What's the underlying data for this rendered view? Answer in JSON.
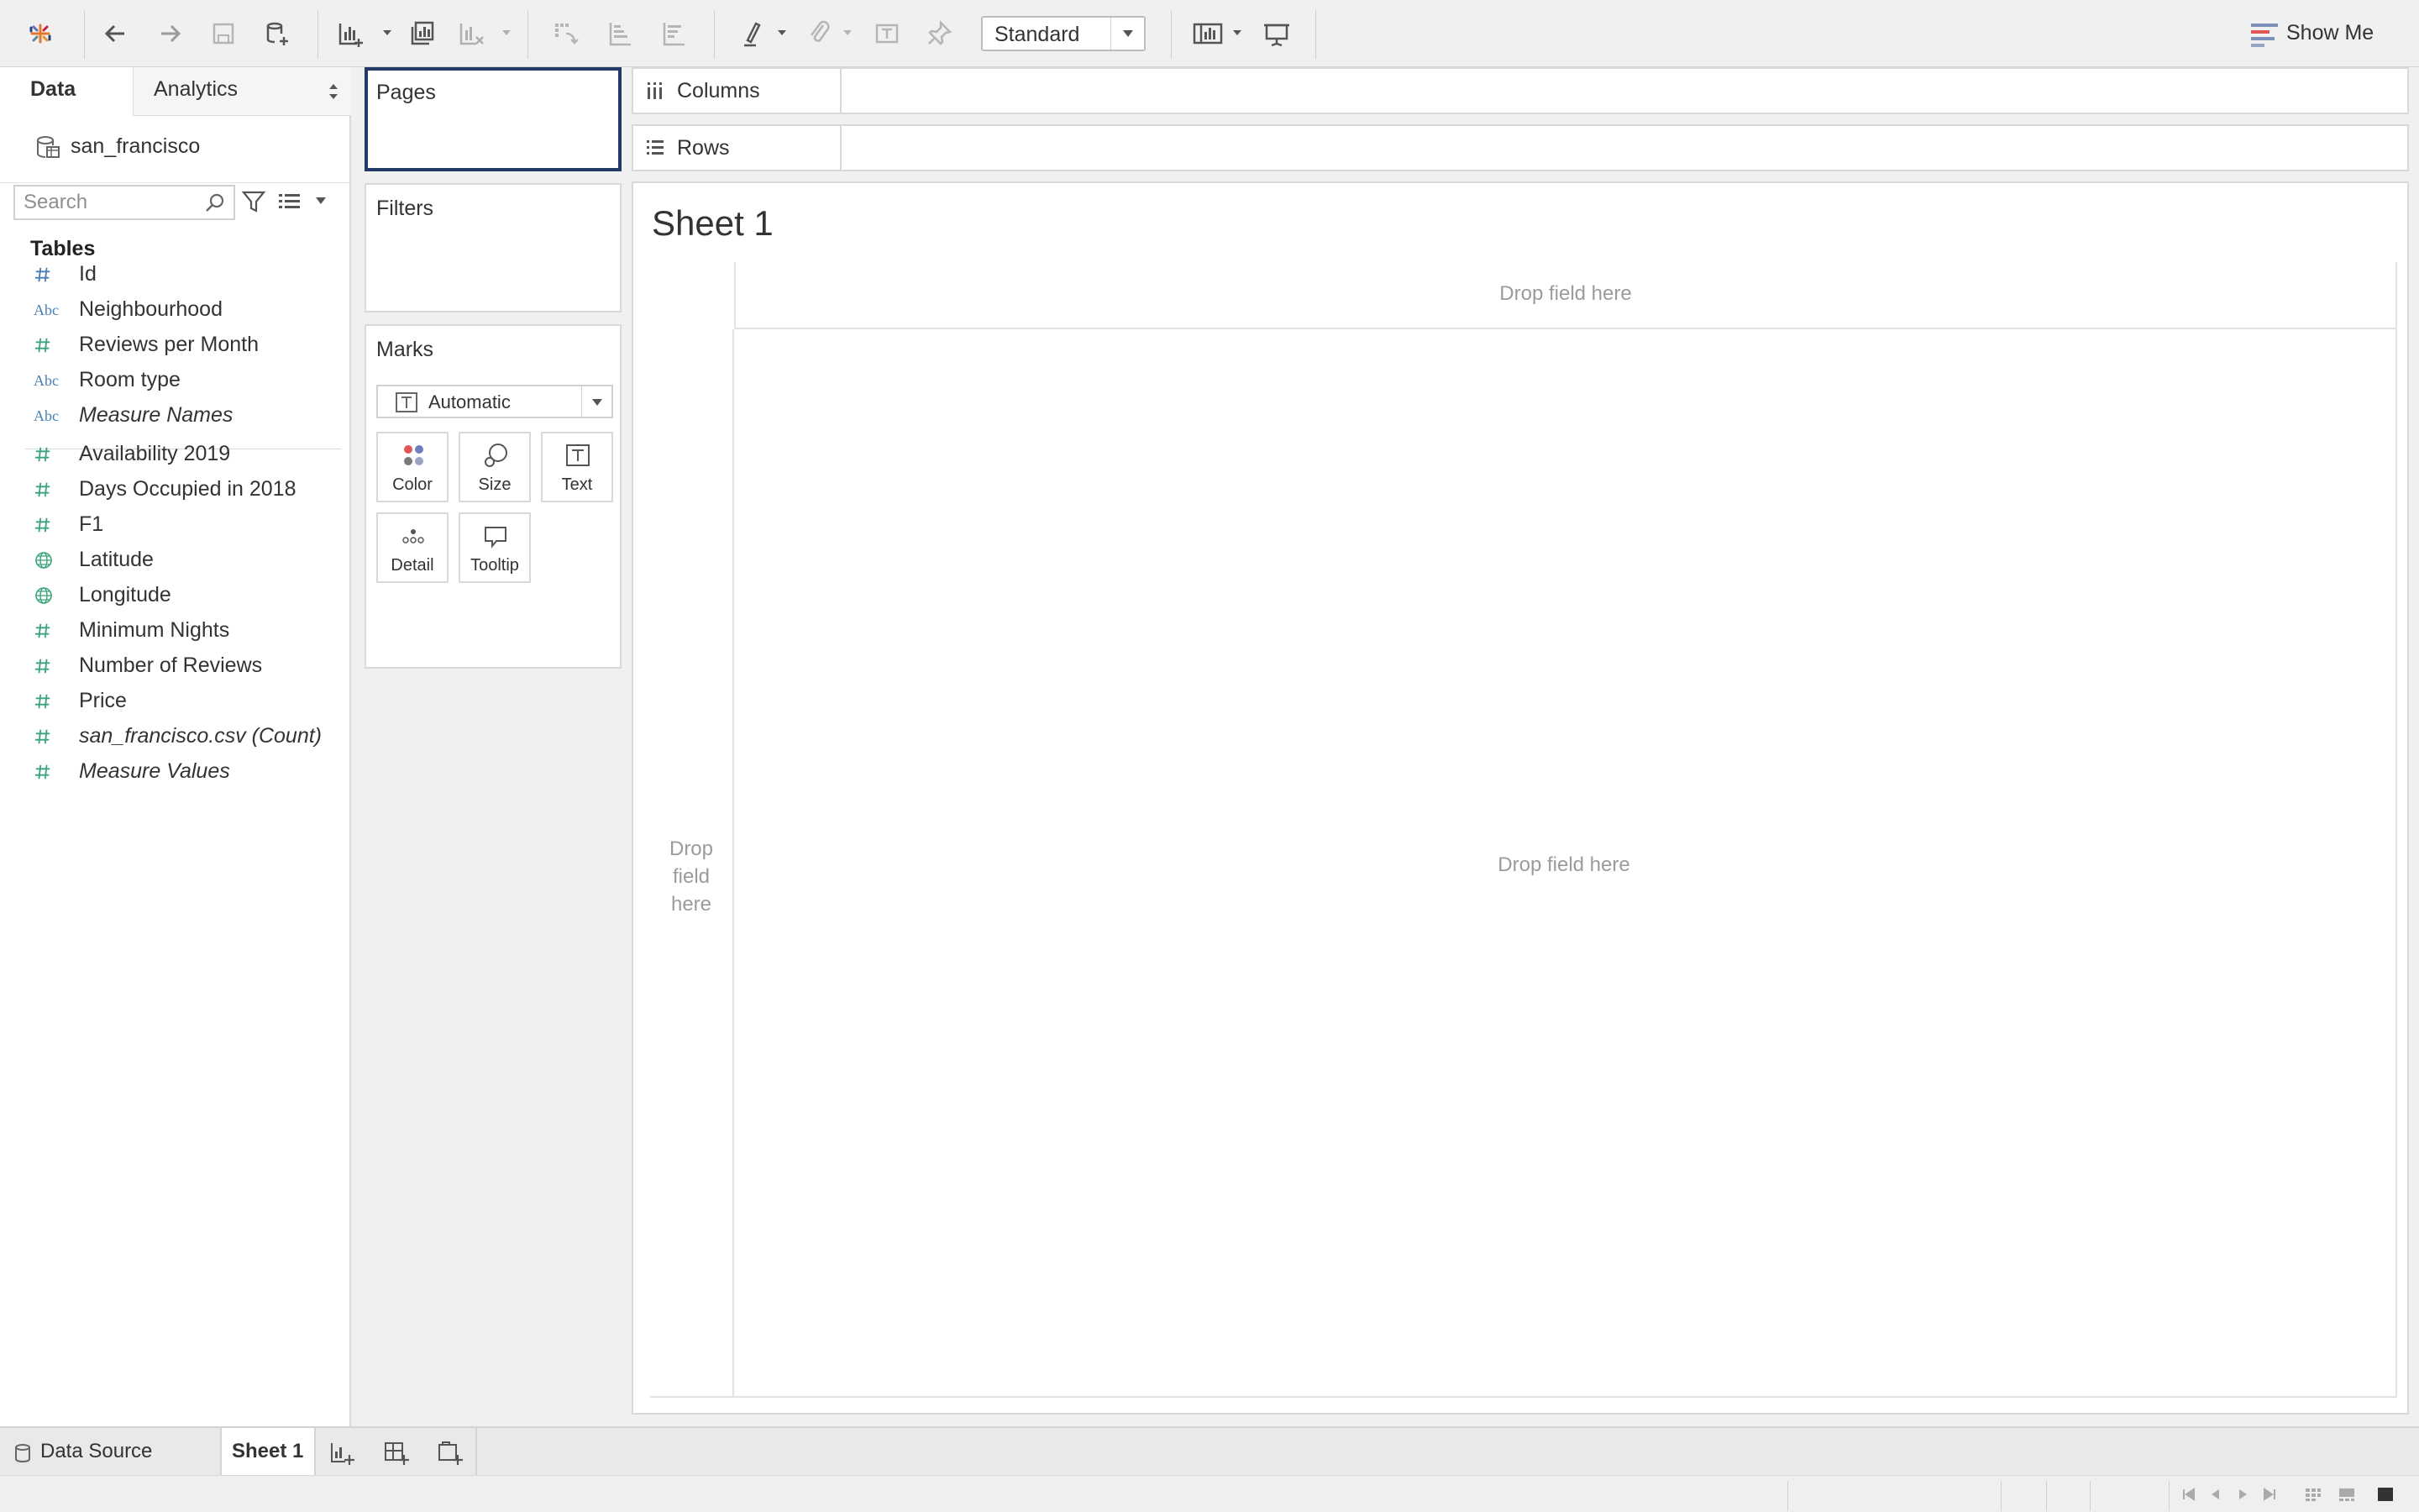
{
  "toolbar": {
    "fit_value": "Standard",
    "show_me_label": "Show Me",
    "icons": [
      "tableau-logo-icon",
      "undo-icon",
      "redo-icon",
      "save-icon",
      "new-datasource-icon",
      "new-worksheet-icon",
      "duplicate-sheet-icon",
      "clear-sheet-icon",
      "swap-icon",
      "sort-ascending-icon",
      "sort-descending-icon",
      "highlight-icon",
      "group-icon",
      "labels-icon",
      "pin-icon",
      "cards-icon",
      "presentation-icon"
    ]
  },
  "data_pane": {
    "tab_data": "Data",
    "tab_analytics": "Analytics",
    "datasource_name": "san_francisco",
    "search_placeholder": "Search",
    "tables_header": "Tables",
    "fields": [
      {
        "name": "Id",
        "type": "number"
      },
      {
        "name": "Neighbourhood",
        "type": "string"
      },
      {
        "name": "Reviews per Month",
        "type": "number"
      },
      {
        "name": "Room type",
        "type": "string"
      },
      {
        "name": "Measure Names",
        "type": "string",
        "italic": true
      },
      {
        "name": "Availability 2019",
        "type": "number"
      },
      {
        "name": "Days Occupied in 2018",
        "type": "number"
      },
      {
        "name": "F1",
        "type": "number"
      },
      {
        "name": "Latitude",
        "type": "geo"
      },
      {
        "name": "Longitude",
        "type": "geo"
      },
      {
        "name": "Minimum Nights",
        "type": "number"
      },
      {
        "name": "Number of Reviews",
        "type": "number"
      },
      {
        "name": "Price",
        "type": "number"
      },
      {
        "name": "san_francisco.csv (Count)",
        "type": "number",
        "italic": true
      },
      {
        "name": "Measure Values",
        "type": "number",
        "italic": true
      }
    ]
  },
  "shelves": {
    "pages": "Pages",
    "filters": "Filters",
    "marks": "Marks",
    "mark_type": "Automatic",
    "mark_buttons": {
      "color": "Color",
      "size": "Size",
      "text": "Text",
      "detail": "Detail",
      "tooltip": "Tooltip"
    },
    "columns": "Columns",
    "rows": "Rows"
  },
  "view": {
    "sheet_title": "Sheet 1",
    "drop_top": "Drop field here",
    "drop_left": "Drop field here",
    "drop_main": "Drop field here"
  },
  "bottom_tabs": {
    "data_source": "Data Source",
    "sheet1": "Sheet 1"
  },
  "colors": {
    "selected_border": "#233a66",
    "dimension_blue": "#4a7fb3",
    "measure_green": "#3aa57a"
  }
}
